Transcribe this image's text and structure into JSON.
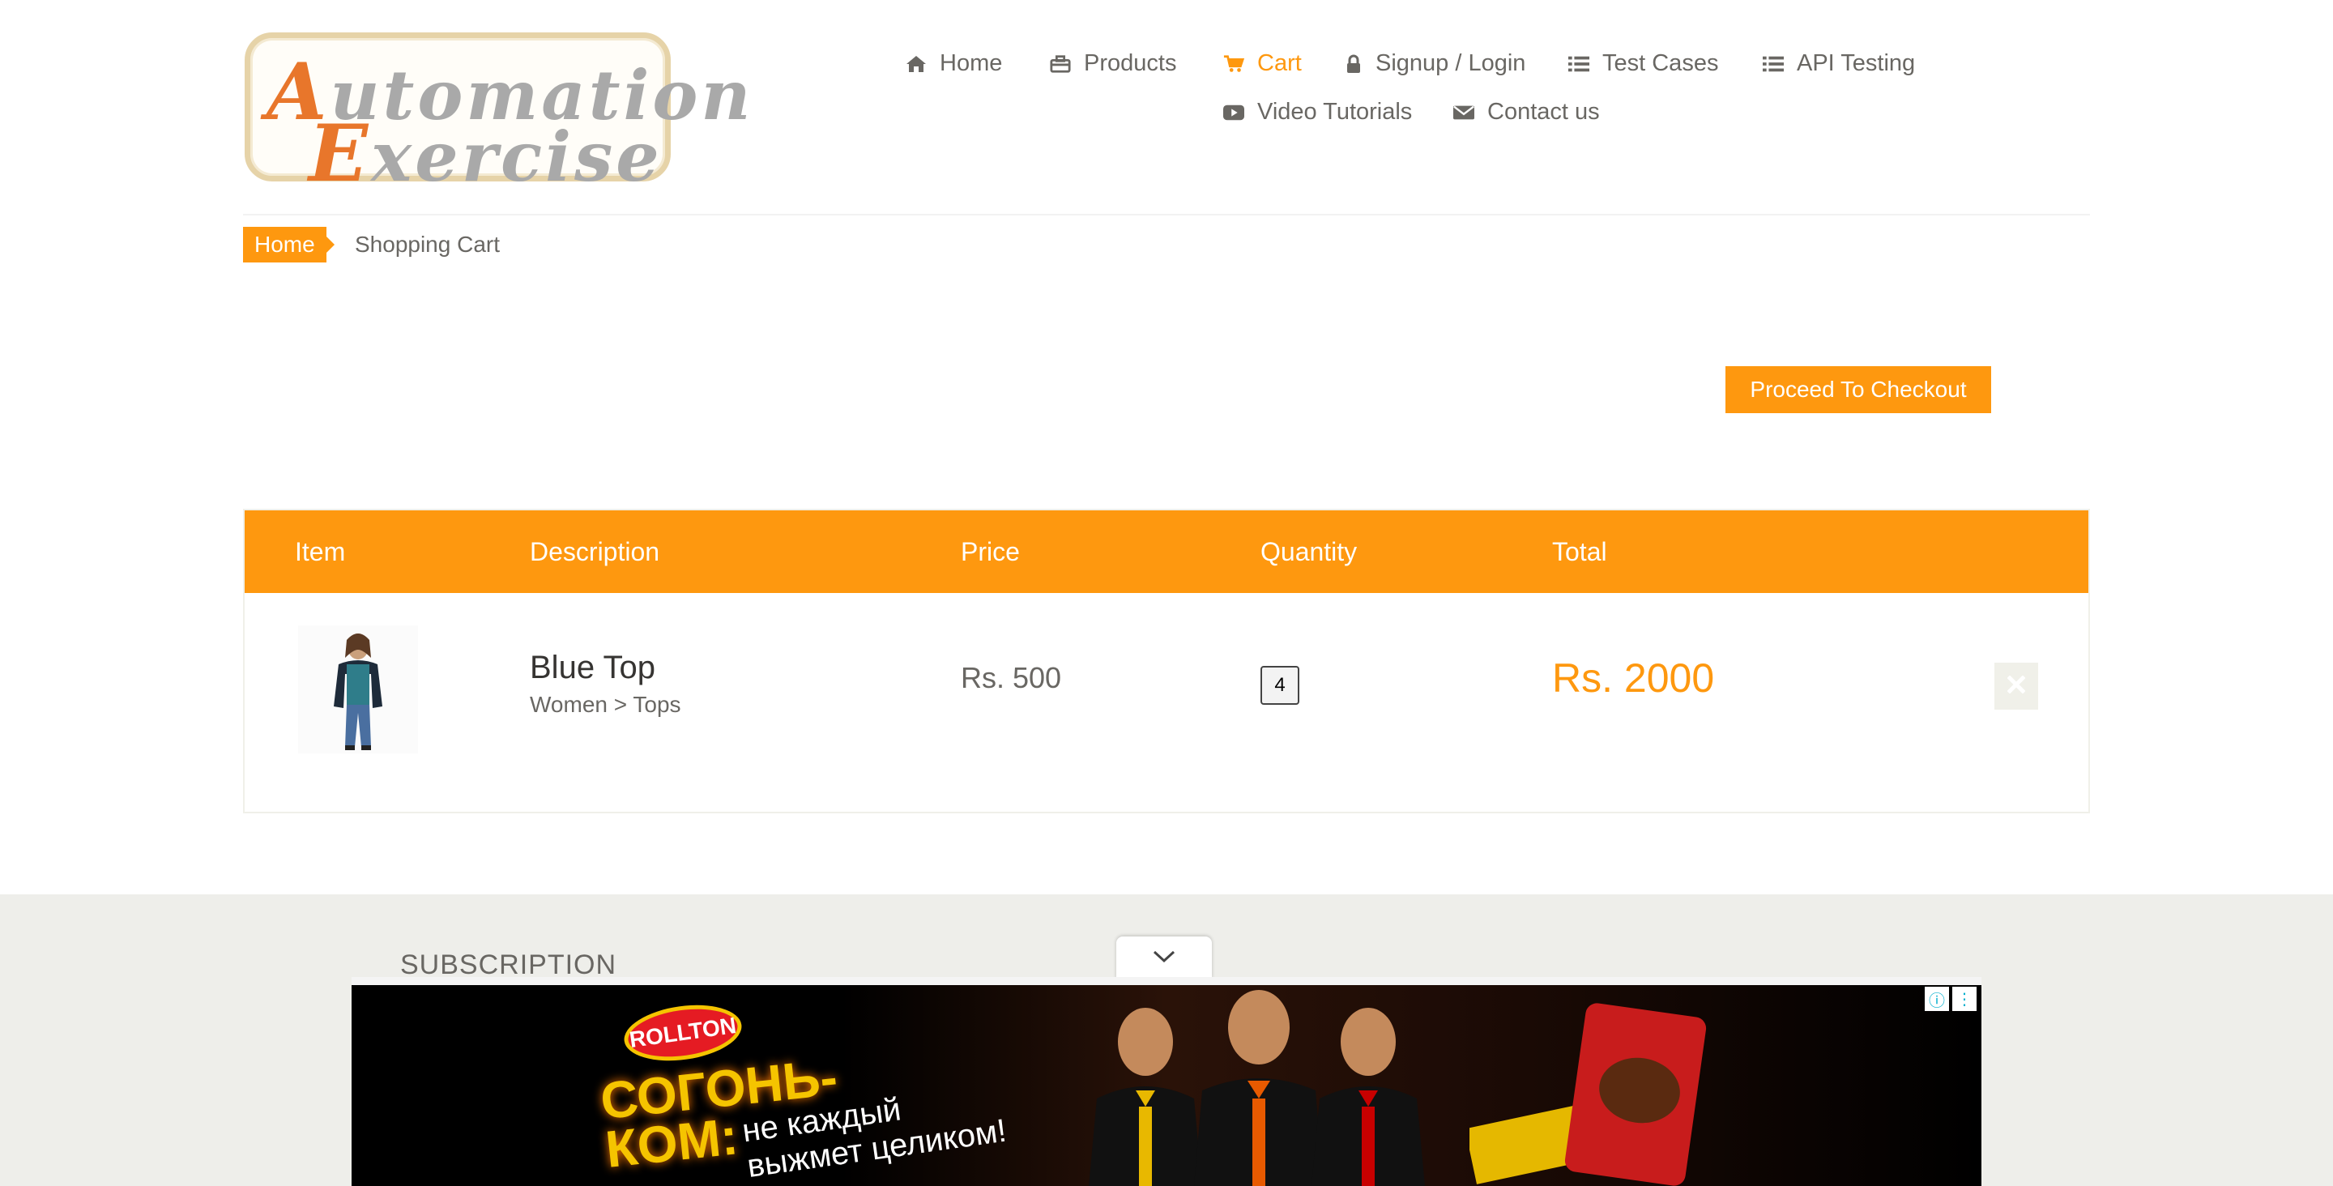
{
  "logo": {
    "line1_cap": "A",
    "line1_rest": "utomation",
    "line2_cap": "E",
    "line2_rest": "xercise"
  },
  "nav": {
    "items": [
      {
        "label": "Home",
        "icon": "home-icon"
      },
      {
        "label": "Products",
        "icon": "briefcase-icon"
      },
      {
        "label": "Cart",
        "icon": "cart-icon",
        "active": true
      },
      {
        "label": "Signup / Login",
        "icon": "lock-icon"
      },
      {
        "label": "Test Cases",
        "icon": "list-icon"
      },
      {
        "label": "API Testing",
        "icon": "list-icon"
      },
      {
        "label": "Video Tutorials",
        "icon": "youtube-play-icon"
      },
      {
        "label": "Contact us",
        "icon": "envelope-icon"
      }
    ]
  },
  "breadcrumb": {
    "home": "Home",
    "current": "Shopping Cart"
  },
  "checkout": {
    "label": "Proceed To Checkout"
  },
  "cart": {
    "headers": {
      "item": "Item",
      "description": "Description",
      "price": "Price",
      "quantity": "Quantity",
      "total": "Total"
    },
    "rows": [
      {
        "name": "Blue Top",
        "category": "Women > Tops",
        "price": "Rs. 500",
        "quantity": "4",
        "total": "Rs. 2000"
      }
    ]
  },
  "footer": {
    "subscription_title": "SUBSCRIPTION"
  },
  "ad": {
    "brand": "ROLLTON",
    "product_line1": "СОГОНЬ-",
    "product_line2": "КОМ:",
    "slogan_line1": "не каждый",
    "slogan_line2": "выжмет целиком!"
  },
  "colors": {
    "accent": "#fe980f",
    "text": "#696763",
    "footer_bg": "#eeeeea"
  }
}
